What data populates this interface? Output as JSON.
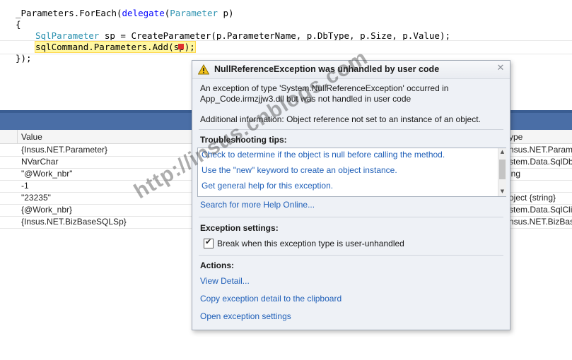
{
  "code": {
    "line1": {
      "pre": "_Parameters.ForEach(",
      "kw": "delegate",
      "mid": "(",
      "type": "Parameter",
      "post": " p)"
    },
    "line2": "{",
    "line3": {
      "type": "SqlParameter",
      "post": " sp = CreateParameter(p.ParameterName, p.DbType, p.Size, p.Value);"
    },
    "line4": "sqlCommand.Parameters.Add(sp);",
    "line5": "});"
  },
  "watch": {
    "columns": {
      "value": "Value",
      "type": "ype"
    },
    "rows": [
      {
        "value": "{Insus.NET.Parameter}",
        "type": "nsus.NET.Paramete"
      },
      {
        "value": "NVarChar",
        "type": "stem.Data.SqlDbTy"
      },
      {
        "value": "\"@Work_nbr\"",
        "type": "ing"
      },
      {
        "value": "-1",
        "type": ""
      },
      {
        "value": "\"23235\"",
        "type": "oject {string}"
      },
      {
        "value": "{@Work_nbr}",
        "type": "stem.Data.SqlClie"
      },
      {
        "value": "{Insus.NET.BizBaseSQLSp}",
        "type": "nsus.NET.BizBaseS("
      }
    ]
  },
  "exception": {
    "title": "NullReferenceException was unhandled by user code",
    "close_icon": "close-icon",
    "message_line1": "An exception of type 'System.NullReferenceException' occurred in",
    "message_line2": "App_Code.irmzjjw3.dll but was not handled in user code",
    "additional_info": "Additional information: Object reference not set to an instance of an object.",
    "tips_heading": "Troubleshooting tips:",
    "tips": [
      "Check to determine if the object is null before calling the method.",
      "Use the \"new\" keyword to create an object instance.",
      "Get general help for this exception."
    ],
    "search_link": "Search for more Help Online...",
    "settings_heading": "Exception settings:",
    "break_checkbox_label": "Break when this exception type is user-unhandled",
    "break_checked": true,
    "actions_heading": "Actions:",
    "actions": [
      "View Detail...",
      "Copy exception detail to the clipboard",
      "Open exception settings"
    ]
  },
  "watermark": "http://insus.cnblogs.com",
  "colors": {
    "toolwindow_title": "#4a6ea6",
    "link": "#1f5fb8",
    "keyword": "#0000ff",
    "type": "#2b91af",
    "highlight": "#fff7a0"
  }
}
